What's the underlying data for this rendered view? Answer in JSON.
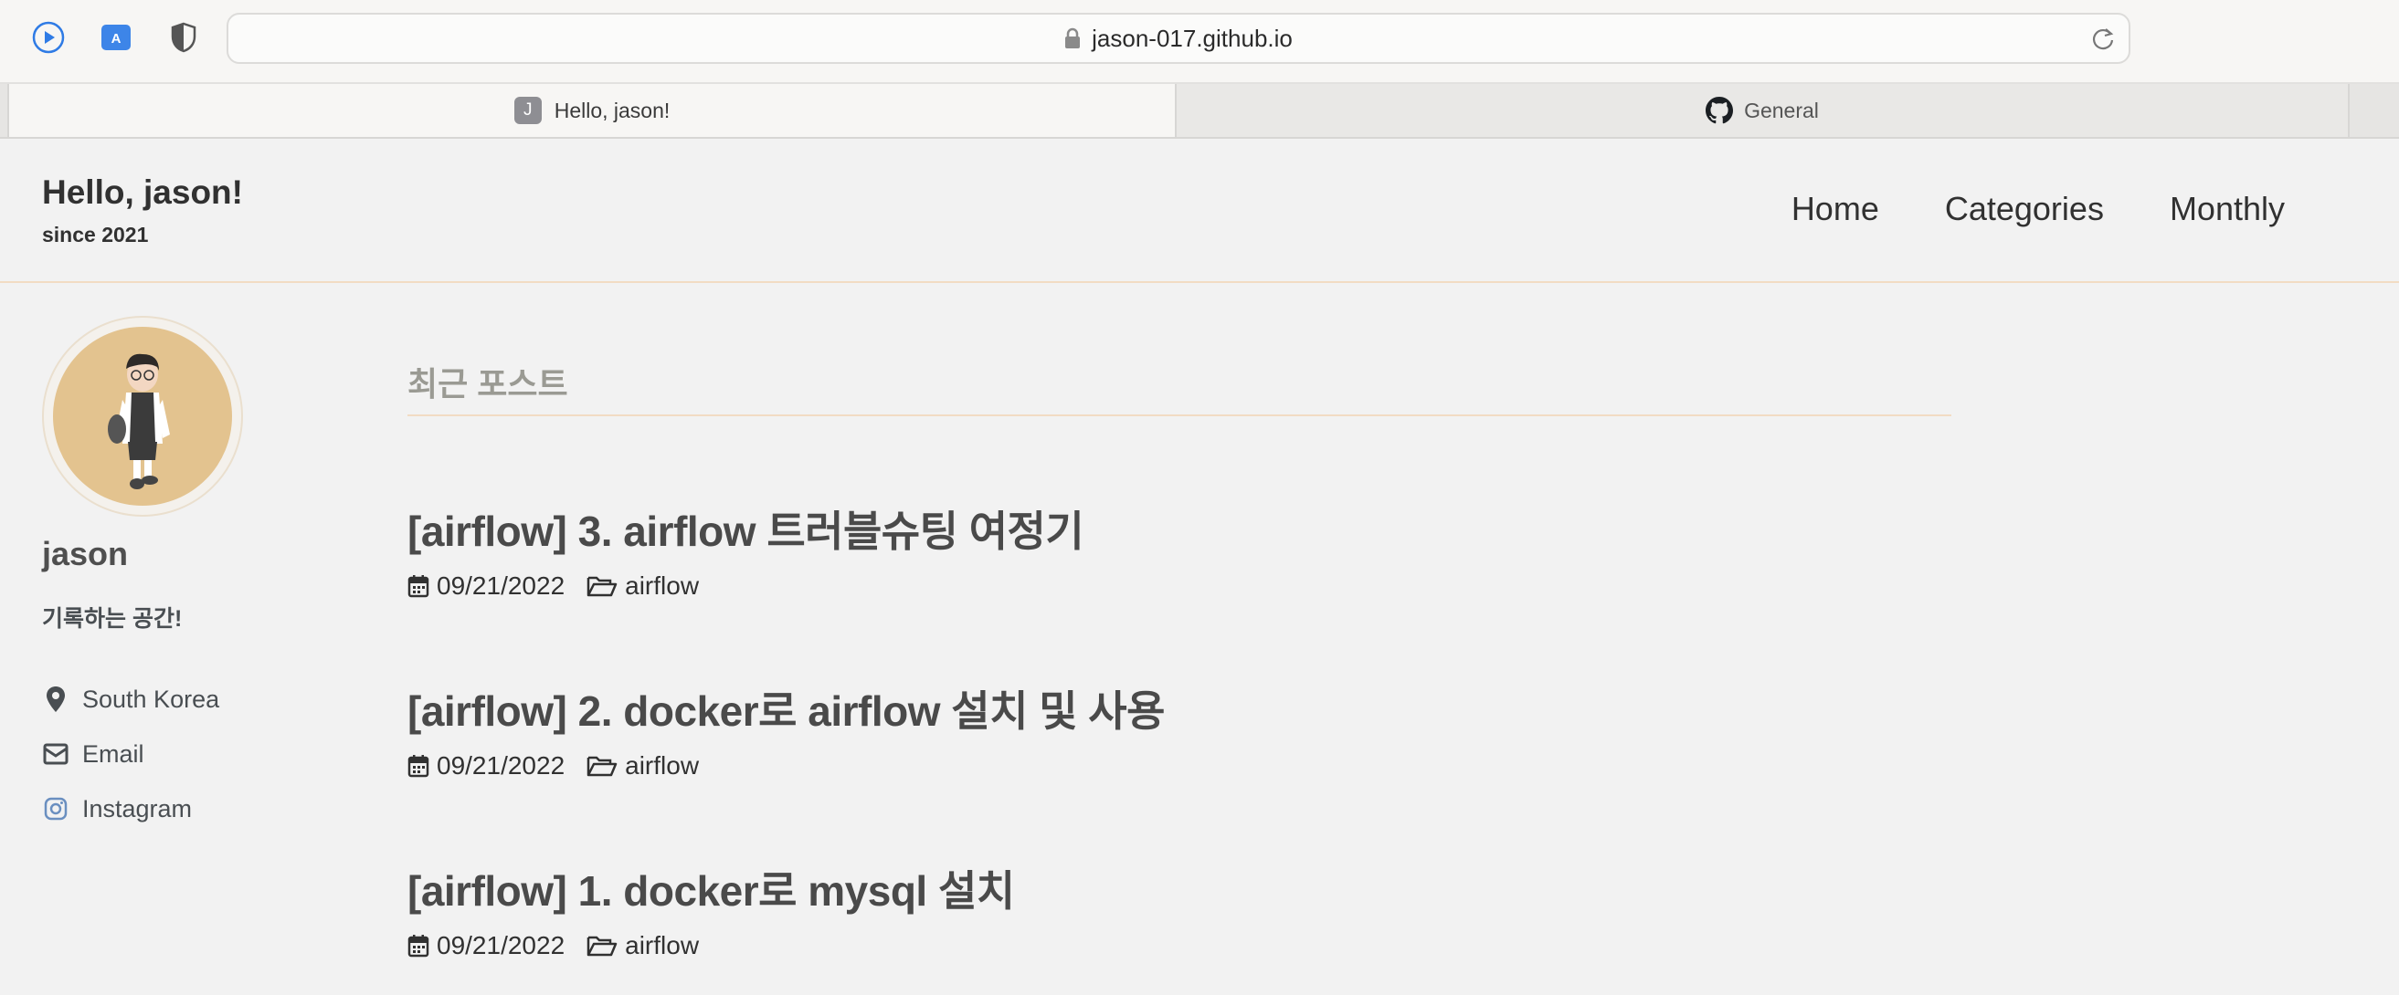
{
  "browser": {
    "url": "jason-017.github.io",
    "tabs": [
      {
        "label": "Hello, jason!",
        "favicon": "J",
        "active": true
      },
      {
        "label": "General",
        "favicon": "github-icon",
        "active": false
      }
    ]
  },
  "site": {
    "title": "Hello, jason!",
    "subtitle": "since 2021",
    "nav": [
      "Home",
      "Categories",
      "Monthly"
    ]
  },
  "author": {
    "name": "jason",
    "bio": "기록하는 공간!",
    "links": [
      {
        "label": "South Korea",
        "icon": "map-pin-icon"
      },
      {
        "label": "Email",
        "icon": "envelope-icon"
      },
      {
        "label": "Instagram",
        "icon": "instagram-icon"
      }
    ]
  },
  "main": {
    "section_title": "최근 포스트",
    "posts": [
      {
        "title": "[airflow] 3. airflow 트러블슈팅 여정기",
        "date": "09/21/2022",
        "category": "airflow"
      },
      {
        "title": "[airflow] 2. docker로 airflow 설치 및 사용",
        "date": "09/21/2022",
        "category": "airflow"
      },
      {
        "title": "[airflow] 1. docker로 mysql 설치",
        "date": "09/21/2022",
        "category": "airflow"
      }
    ]
  },
  "colors": {
    "accent_border": "#f2dcc3",
    "avatar_bg": "#e3c38f",
    "page_bg": "#f2f2f2"
  }
}
